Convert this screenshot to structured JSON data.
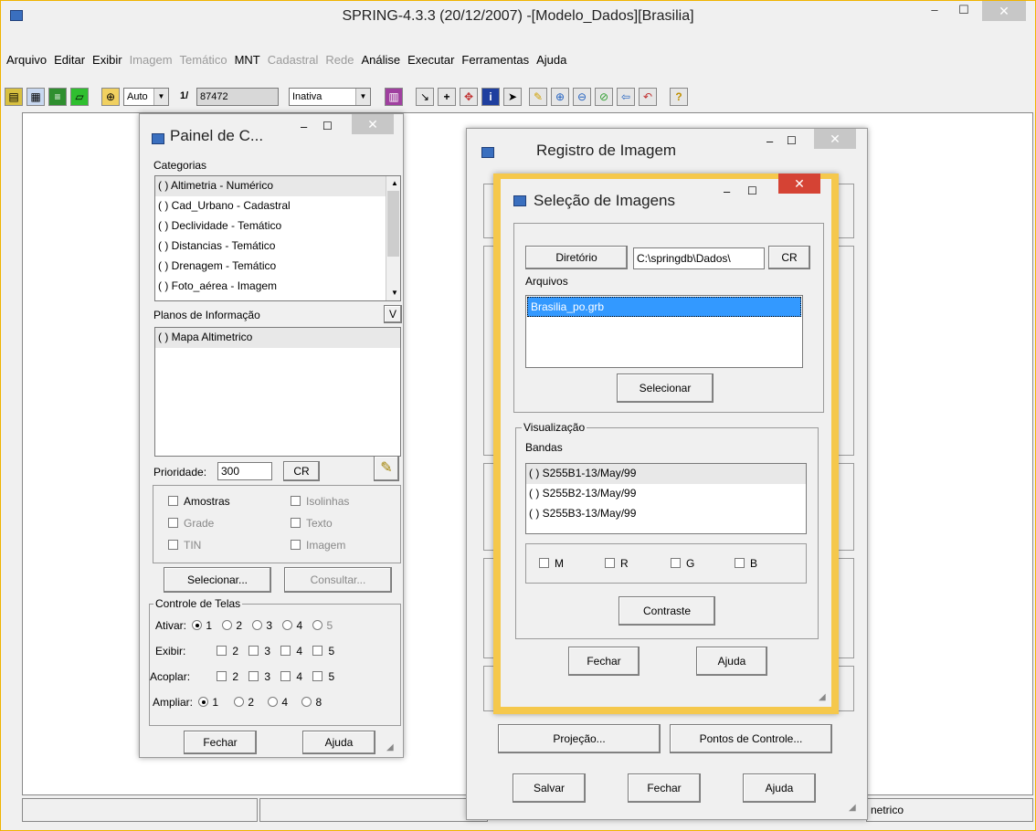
{
  "window": {
    "title": "SPRING-4.3.3 (20/12/2007) -[Modelo_Dados][Brasilia]"
  },
  "menubar": [
    {
      "label": "Arquivo",
      "enabled": true
    },
    {
      "label": "Editar",
      "enabled": true
    },
    {
      "label": "Exibir",
      "enabled": true
    },
    {
      "label": "Imagem",
      "enabled": false
    },
    {
      "label": "Temático",
      "enabled": false
    },
    {
      "label": "MNT",
      "enabled": true
    },
    {
      "label": "Cadastral",
      "enabled": false
    },
    {
      "label": "Rede",
      "enabled": false
    },
    {
      "label": "Análise",
      "enabled": true
    },
    {
      "label": "Executar",
      "enabled": true
    },
    {
      "label": "Ferramentas",
      "enabled": true
    },
    {
      "label": "Ajuda",
      "enabled": true
    }
  ],
  "toolbar": {
    "zoom_mode": "Auto",
    "scale_prefix": "1/",
    "scale_value": "87472",
    "mode": "Inativa",
    "plus_symbol": "+",
    "info_symbol": "i",
    "help_symbol": "?"
  },
  "statusbar": {
    "right_text": "netrico"
  },
  "painel": {
    "title": "Painel de C...",
    "categorias_label": "Categorias",
    "categorias": [
      "( ) Altimetria - Numérico",
      "( ) Cad_Urbano - Cadastral",
      "( ) Declividade - Temático",
      "( ) Distancias - Temático",
      "( ) Drenagem - Temático",
      "( ) Foto_aérea - Imagem"
    ],
    "planos_label": "Planos de Informação",
    "v_button": "V",
    "planos": [
      "( ) Mapa Altimetrico"
    ],
    "prioridade_label": "Prioridade:",
    "prioridade_value": "300",
    "cr_button": "CR",
    "checks": {
      "amostras": "Amostras",
      "isolinhas": "Isolinhas",
      "grade": "Grade",
      "texto": "Texto",
      "tin": "TIN",
      "imagem": "Imagem"
    },
    "selecionar_button": "Selecionar...",
    "consultar_button": "Consultar...",
    "controle_label": "Controle de Telas",
    "ativar_label": "Ativar:",
    "ativar_options": [
      "1",
      "2",
      "3",
      "4",
      "5"
    ],
    "exibir_label": "Exibir:",
    "acoplar_label": "Acoplar:",
    "screen_options": [
      "2",
      "3",
      "4",
      "5"
    ],
    "ampliar_label": "Ampliar:",
    "ampliar_options": [
      "1",
      "2",
      "4",
      "8"
    ],
    "fechar_button": "Fechar",
    "ajuda_button": "Ajuda"
  },
  "registro": {
    "title": "Registro de Imagem",
    "projecao_button": "Projeção...",
    "pontos_button": "Pontos de Controle...",
    "salvar_button": "Salvar",
    "fechar_button": "Fechar",
    "ajuda_button": "Ajuda"
  },
  "selecao": {
    "title": "Seleção de Imagens",
    "diretorio_button": "Diretório",
    "diretorio_value": "C:\\springdb\\Dados\\",
    "cr_button": "CR",
    "arquivos_label": "Arquivos",
    "arquivos": [
      "Brasilia_po.grb"
    ],
    "selecionar_button": "Selecionar",
    "visualizacao_label": "Visualização",
    "bandas_label": "Bandas",
    "bandas": [
      "( ) S255B1-13/May/99",
      "( ) S255B2-13/May/99",
      "( ) S255B3-13/May/99"
    ],
    "channels": [
      "M",
      "R",
      "G",
      "B"
    ],
    "contraste_button": "Contraste",
    "fechar_button": "Fechar",
    "ajuda_button": "Ajuda"
  },
  "colors": {
    "accent_border": "#f5c84c",
    "selection": "#3399ff",
    "close_red": "#d54334"
  }
}
